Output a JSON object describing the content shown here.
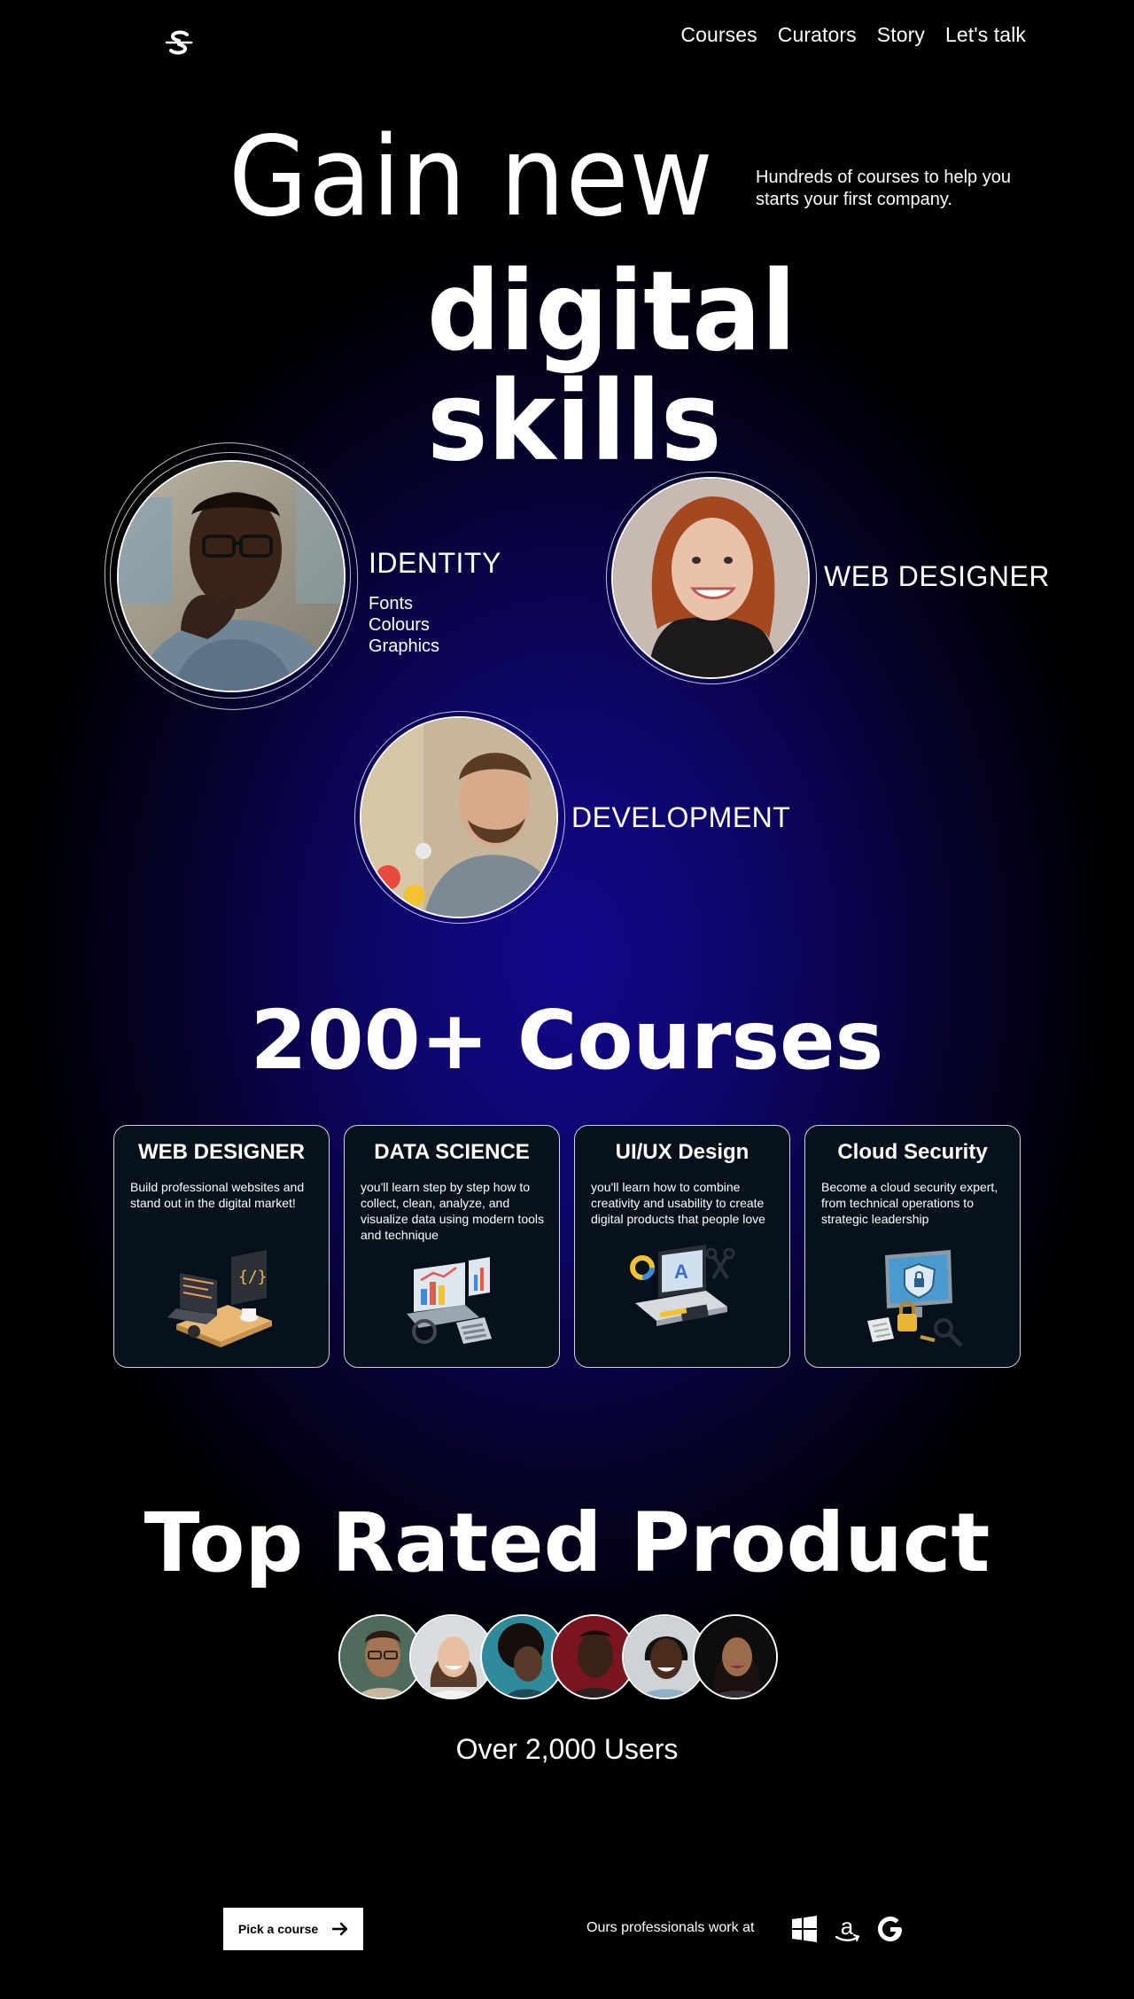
{
  "nav": {
    "logo_icon": "strikethrough-s-logo-icon",
    "items": [
      "Courses",
      "Curators",
      "Story",
      "Let's talk"
    ]
  },
  "hero": {
    "line1": "Gain new",
    "line2": "digital skills",
    "subtitle": "Hundreds of courses to help you starts your first company."
  },
  "portraits": [
    {
      "label": "IDENTITY",
      "items": [
        "Fonts",
        "Colours",
        "Graphics"
      ]
    },
    {
      "label": "WEB DESIGNER",
      "items": []
    },
    {
      "label": "DEVELOPMENT",
      "items": []
    }
  ],
  "courses": {
    "title": "200+ Courses",
    "cards": [
      {
        "title": "WEB DESIGNER",
        "desc": "Build professional websites and stand out in the digital market!",
        "icon": "laptop-code-illustration-icon"
      },
      {
        "title": "DATA SCIENCE",
        "desc": "you'll learn step by step how to collect, clean, analyze, and visualize data using modern tools and technique",
        "icon": "laptop-charts-illustration-icon"
      },
      {
        "title": "UI/UX Design",
        "desc": "you'll learn how to combine creativity and usability to create digital products that people love",
        "icon": "laptop-design-tools-illustration-icon"
      },
      {
        "title": "Cloud Security",
        "desc": "Become a cloud security expert, from technical operations to strategic leadership",
        "icon": "monitor-shield-lock-illustration-icon"
      }
    ]
  },
  "rated": {
    "title": "Top Rated Product",
    "users": "Over 2,000 Users"
  },
  "footer": {
    "cta": "Pick a course",
    "pro_text": "Ours professionals work at",
    "brands": [
      "windows-icon",
      "amazon-icon",
      "google-icon"
    ]
  },
  "colors": {
    "background_glow": "#14068c",
    "background_edge": "#000000",
    "card_bg": "#06111c",
    "text": "#ffffff"
  }
}
